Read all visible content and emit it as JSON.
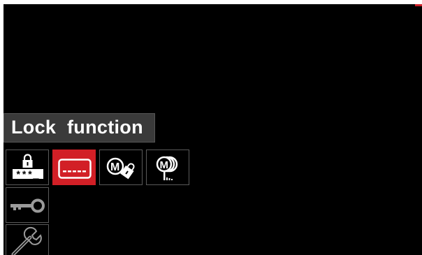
{
  "screen": {
    "title": "Lock function",
    "accent_color": "#d21f26"
  },
  "toolbar": {
    "items": [
      {
        "name": "password-lock",
        "icon": "lock-password-icon",
        "selected": false,
        "text": "***_"
      },
      {
        "name": "lock-screen",
        "icon": "keypad-panel-icon",
        "selected": true
      },
      {
        "name": "memory-lock",
        "icon": "memory-lock-icon",
        "selected": false,
        "text": "M"
      },
      {
        "name": "memory-limits",
        "icon": "memory-limits-icon",
        "selected": false,
        "text": "M"
      }
    ]
  },
  "side_menu": {
    "items": [
      {
        "name": "key",
        "icon": "key-icon"
      },
      {
        "name": "tools",
        "icon": "wrench-icon"
      }
    ]
  }
}
